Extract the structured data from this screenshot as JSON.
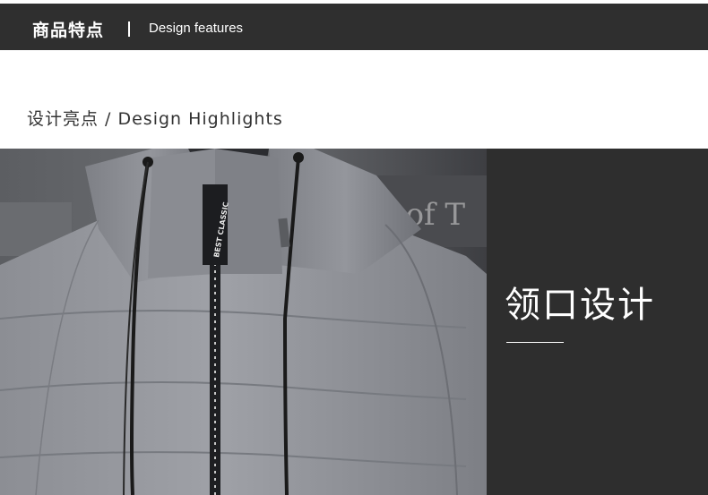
{
  "header": {
    "title_cn": "商品特点",
    "title_en": "Design features",
    "background": "#2f2f2f"
  },
  "section": {
    "title": "设计亮点 / Design Highlights"
  },
  "photo": {
    "alt": "grey hooded puffer jacket collar close-up",
    "tag_text": "BEST CLASSIC",
    "background_sign_text": "d of T"
  },
  "panel": {
    "title": "领口设计",
    "background": "#2e2e2e"
  }
}
